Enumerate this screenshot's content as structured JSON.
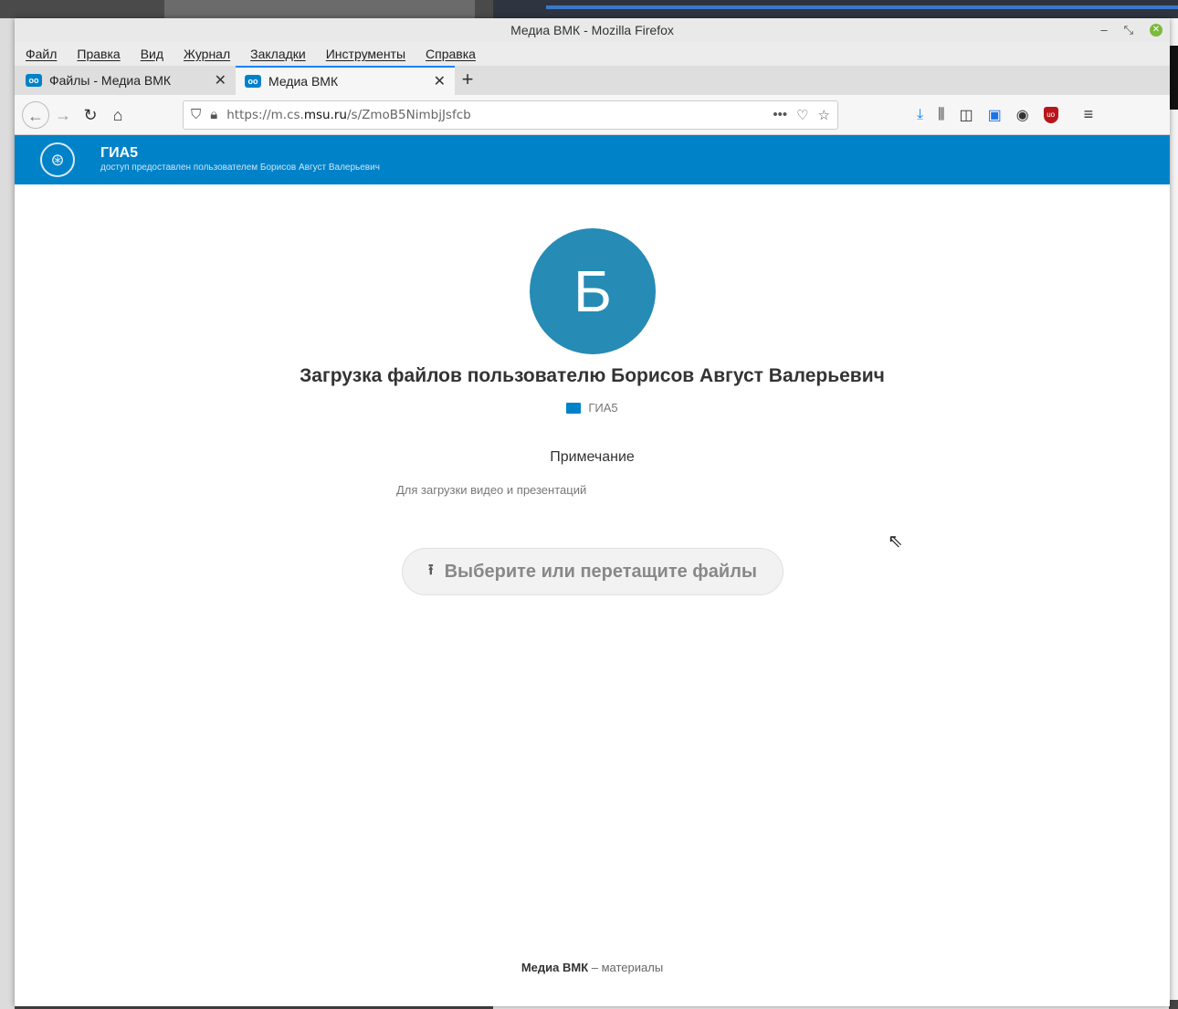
{
  "window": {
    "title": "Медиа ВМК - Mozilla Firefox"
  },
  "menu": [
    "Файл",
    "Правка",
    "Вид",
    "Журнал",
    "Закладки",
    "Инструменты",
    "Справка"
  ],
  "tabs": [
    {
      "label": "Файлы - Медиа ВМК",
      "active": false
    },
    {
      "label": "Медиа ВМК",
      "active": true
    }
  ],
  "address_bar": {
    "url_prefix": "https://m.cs.",
    "url_domain": "msu.ru",
    "url_path": "/s/ZmoB5NimbjJsfcb"
  },
  "header": {
    "title": "ГИА5",
    "subtitle": "доступ предоставлен пользователем Борисов Август Валерьевич"
  },
  "share": {
    "avatar_letter": "Б",
    "heading": "Загрузка файлов пользователю Борисов Август Валерьевич",
    "folder_name": "ГИА5",
    "note_label": "Примечание",
    "note_text": "Для загрузки видео и презентаций",
    "upload_label": "Выберите или перетащите файлы"
  },
  "footer": {
    "brand": "Медиа ВМК",
    "separator": " – ",
    "text": "материалы"
  },
  "colors": {
    "accent": "#0082c9",
    "avatar": "#268bb5"
  }
}
